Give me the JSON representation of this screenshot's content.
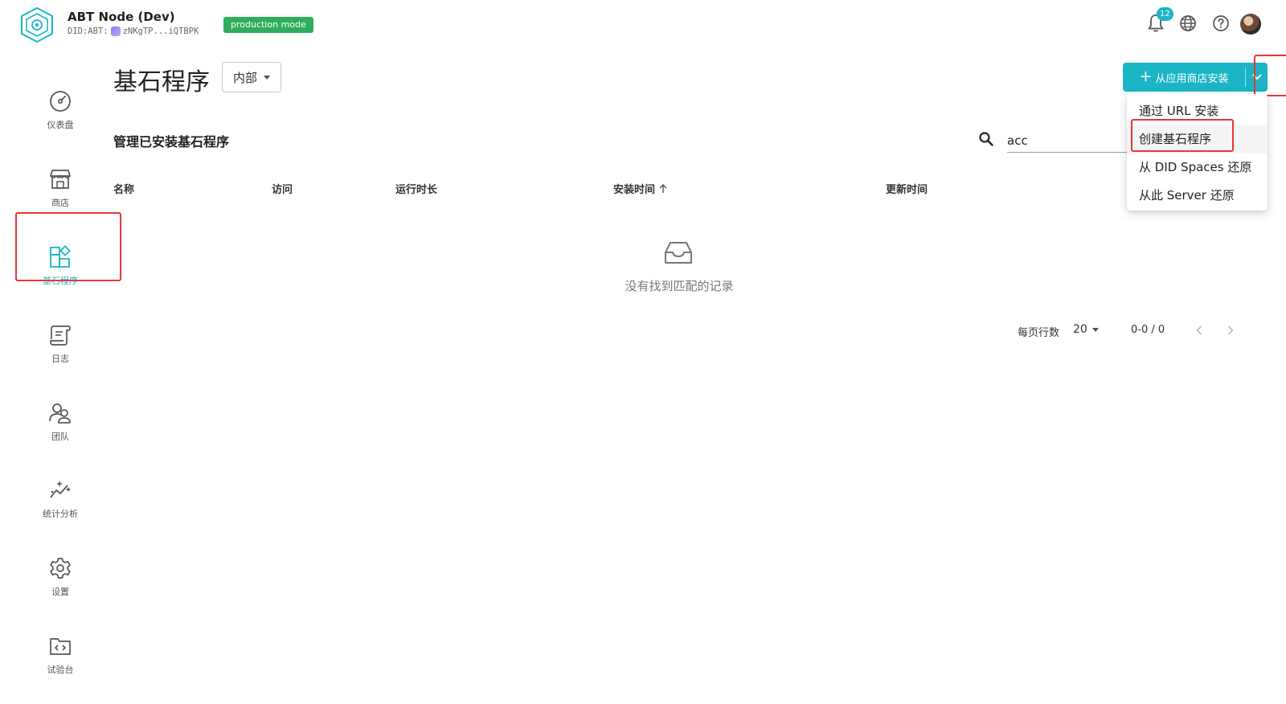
{
  "header": {
    "app_title": "ABT Node (Dev)",
    "did_prefix": "DID:ABT:",
    "did_value": "zNKgTP...iQTBPK",
    "mode_badge": "production mode",
    "notification_count": "12",
    "icons": [
      "bell-icon",
      "globe-icon",
      "help-icon",
      "user-avatar"
    ]
  },
  "sidebar": {
    "items": [
      {
        "label": "仪表盘",
        "icon": "dashboard-gauge-icon"
      },
      {
        "label": "商店",
        "icon": "store-icon"
      },
      {
        "label": "基石程序",
        "icon": "blocklets-icon",
        "active": true
      },
      {
        "label": "日志",
        "icon": "log-scroll-icon"
      },
      {
        "label": "团队",
        "icon": "team-users-icon"
      },
      {
        "label": "统计分析",
        "icon": "analytics-sparkle-icon"
      },
      {
        "label": "设置",
        "icon": "settings-gear-icon"
      },
      {
        "label": "试验台",
        "icon": "playground-code-folder-icon"
      }
    ]
  },
  "main": {
    "page_title": "基石程序",
    "scope_select": "内部",
    "section_title": "管理已安装基石程序",
    "search": {
      "value": "acc"
    },
    "install_button": {
      "label": "从应用商店安装"
    },
    "install_menu": {
      "items": [
        "通过 URL 安装",
        "创建基石程序",
        "从 DID Spaces 还原",
        "从此 Server 还原"
      ]
    },
    "table": {
      "columns": [
        "名称",
        "访问",
        "运行时长",
        "安装时间",
        "更新时间"
      ],
      "sorted_column": "安装时间",
      "empty_text": "没有找到匹配的记录"
    },
    "pagination": {
      "rows_per_page_label": "每页行数",
      "rows_per_page": "20",
      "range": "0-0 / 0"
    }
  },
  "colors": {
    "accent": "#1bb5c5",
    "badge_green": "#2eae5c",
    "highlight_red": "#e53935"
  }
}
